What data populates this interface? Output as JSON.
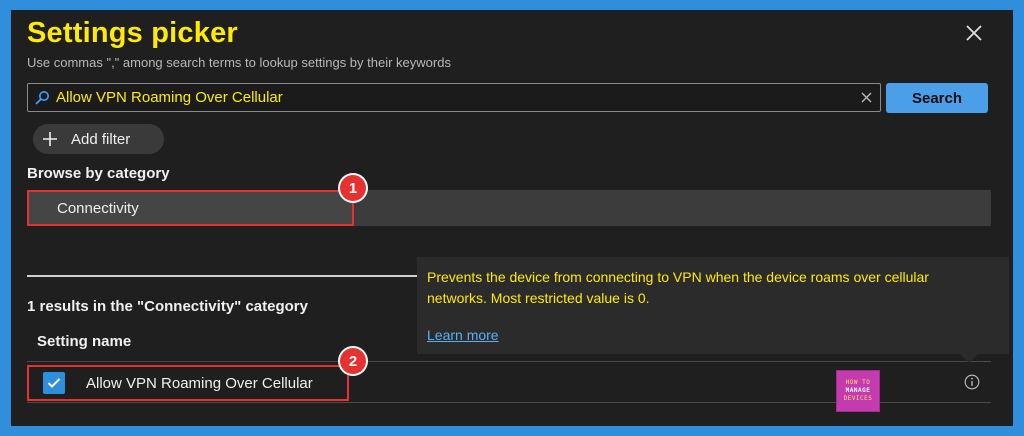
{
  "header": {
    "title": "Settings picker",
    "subtitle": "Use commas \",\" among search terms to lookup settings by their keywords",
    "close_icon": "close-icon"
  },
  "search": {
    "value": "Allow VPN Roaming Over Cellular",
    "placeholder": "",
    "button_label": "Search",
    "icon": "search-icon"
  },
  "filter": {
    "add_label": "Add filter"
  },
  "browse": {
    "label": "Browse by category",
    "categories": [
      {
        "label": "Connectivity",
        "selected": true
      }
    ]
  },
  "results": {
    "summary": "1 results in the \"Connectivity\" category",
    "column_header": "Setting name",
    "rows": [
      {
        "name": "Allow VPN Roaming Over Cellular",
        "checked": true
      }
    ]
  },
  "tooltip": {
    "text": "Prevents the device from connecting to VPN when the device roams over cellular networks. Most restricted value is 0.",
    "link": "Learn more"
  },
  "watermark": {
    "lines": [
      "HOW TO",
      "MANAGE",
      "DEVICES"
    ]
  },
  "callouts": [
    "1",
    "2"
  ],
  "colors": {
    "accent": "#2f8fdc",
    "title": "#ffeb00",
    "highlight": "#e5312f",
    "panel": "#1f1f1f"
  }
}
